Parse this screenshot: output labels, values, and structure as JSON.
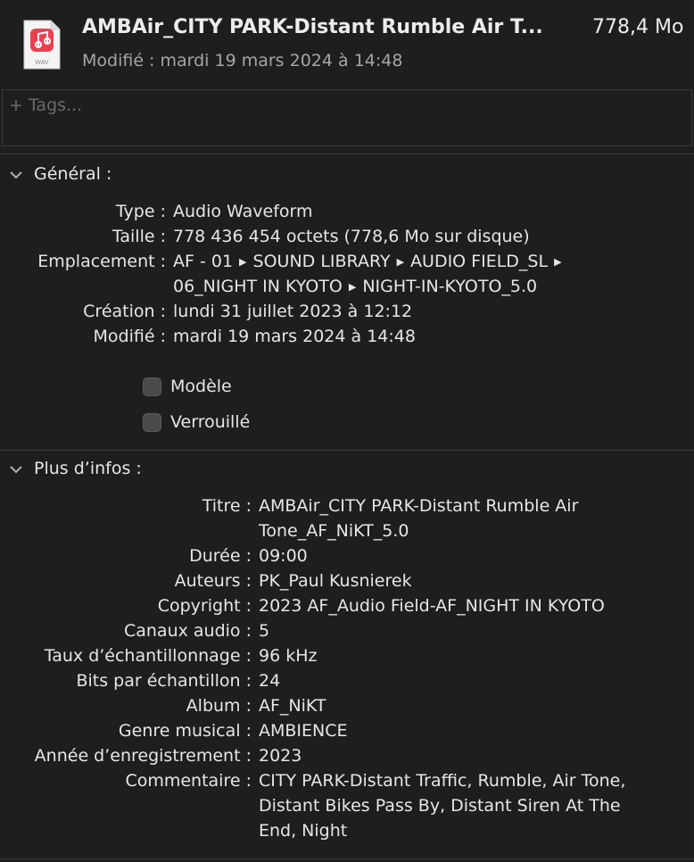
{
  "header": {
    "title": "AMBAir_CITY PARK-Distant Rumble Air T...",
    "size": "778,4 Mo",
    "modified": "Modifié : mardi 19 mars 2024 à 14:48",
    "icon_badge": "WAV",
    "icon_name": "music-note-icon"
  },
  "tags": {
    "placeholder": "+ Tags..."
  },
  "general": {
    "title": "Général :",
    "rows": {
      "type": {
        "label": "Type :",
        "value": "Audio Waveform"
      },
      "taille": {
        "label": "Taille :",
        "value": "778 436 454 octets (778,6 Mo sur disque)"
      },
      "emplacement": {
        "label": "Emplacement :",
        "path1": [
          "AF - 01",
          "SOUND LIBRARY",
          "AUDIO FIELD_SL"
        ],
        "path2": [
          "06_NIGHT IN KYOTO",
          "NIGHT-IN-KYOTO_5.0"
        ]
      },
      "creation": {
        "label": "Création :",
        "value": "lundi 31 juillet 2023 à 12:12"
      },
      "modifie": {
        "label": "Modifié :",
        "value": "mardi 19 mars 2024 à 14:48"
      }
    },
    "checkboxes": {
      "modele": "Modèle",
      "verrouille": "Verrouillé"
    }
  },
  "more_info": {
    "title": "Plus d’infos :",
    "rows": {
      "titre": {
        "label": "Titre :",
        "value1": "AMBAir_CITY PARK-Distant Rumble Air",
        "value2": "Tone_AF_NiKT_5.0"
      },
      "duree": {
        "label": "Durée :",
        "value": "09:00"
      },
      "auteurs": {
        "label": "Auteurs :",
        "value": "PK_Paul Kusnierek"
      },
      "copyright": {
        "label": "Copyright :",
        "value": "2023 AF_Audio Field-AF_NIGHT IN KYOTO"
      },
      "canaux": {
        "label": "Canaux audio :",
        "value": "5"
      },
      "taux": {
        "label": "Taux d’échantillonnage :",
        "value": "96 kHz"
      },
      "bits": {
        "label": "Bits par échantillon :",
        "value": "24"
      },
      "album": {
        "label": "Album :",
        "value": "AF_NiKT"
      },
      "genre": {
        "label": "Genre musical :",
        "value": "AMBIENCE"
      },
      "annee": {
        "label": "Année d’enregistrement :",
        "value": "2023"
      },
      "commentaire": {
        "label": "Commentaire :",
        "value1": "CITY PARK-Distant Traffic, Rumble, Air Tone,",
        "value2": "Distant Bikes Pass By, Distant Siren At The",
        "value3": "End, Night"
      }
    }
  },
  "colors": {
    "background": "#1e1e1e",
    "text": "#e6e6e6",
    "secondary": "#a5a5a5",
    "icon_accent": "#e8404f"
  }
}
